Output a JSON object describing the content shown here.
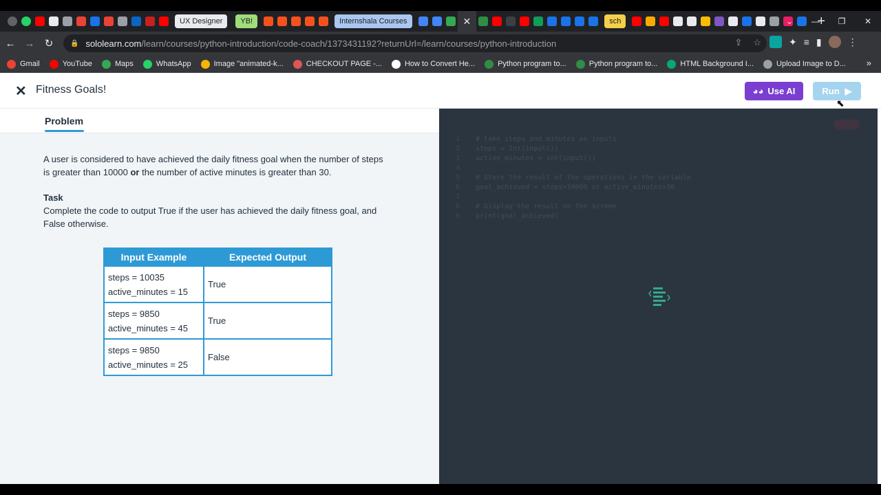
{
  "browser": {
    "tabs": [
      {
        "label": "UX Designer",
        "color": "#e8eaed"
      },
      {
        "label": "YB!",
        "color": "#9fdc7a"
      },
      {
        "label": "Internshala Courses",
        "color": "#a9c7f0"
      },
      {
        "label": "sch",
        "color": "#f5d04a"
      }
    ],
    "active_tab_close": "✕",
    "new_tab": "+",
    "url_domain": "sololearn.com",
    "url_path": "/learn/courses/python-introduction/code-coach/1373431192?returnUrl=/learn/courses/python-introduction"
  },
  "bookmarks": [
    {
      "label": "Gmail",
      "color": "#ea4335"
    },
    {
      "label": "YouTube",
      "color": "#ff0000"
    },
    {
      "label": "Maps",
      "color": "#34a853"
    },
    {
      "label": "WhatsApp",
      "color": "#25d366"
    },
    {
      "label": "Image \"animated-k...",
      "color": "#f7b500"
    },
    {
      "label": "CHECKOUT PAGE -...",
      "color": "#e05555"
    },
    {
      "label": "How to Convert He...",
      "color": "#ffffff"
    },
    {
      "label": "Python program to...",
      "color": "#2f8d46"
    },
    {
      "label": "Python program to...",
      "color": "#2f8d46"
    },
    {
      "label": "HTML Background I...",
      "color": "#04aa6d"
    },
    {
      "label": "Upload Image to D...",
      "color": "#9aa0a6"
    }
  ],
  "bookmarks_more": "»",
  "header": {
    "title": "Fitness Goals!",
    "use_ai_label": "Use AI",
    "run_label": "Run",
    "accent": "#7a3fd0",
    "run_color": "#a5d4ef"
  },
  "problem": {
    "tab_label": "Problem",
    "description_part1": "A user is considered to have achieved the daily fitness goal when the number of steps is greater than 10000 ",
    "description_bold": "or",
    "description_part2": " the number of active minutes is greater than 30.",
    "task_heading": "Task",
    "task_text": "Complete the code to output True if the user has achieved the daily fitness goal, and False otherwise."
  },
  "examples": {
    "headers": [
      "Input Example",
      "Expected Output"
    ],
    "rows": [
      {
        "input_line1": "steps = 10035",
        "input_line2": "active_minutes = 15",
        "output": "True"
      },
      {
        "input_line1": "steps = 9850",
        "input_line2": "active_minutes = 45",
        "output": "True"
      },
      {
        "input_line1": "steps = 9850",
        "input_line2": "active_minutes = 25",
        "output": "False"
      }
    ]
  },
  "code": {
    "lines": [
      {
        "num": "1",
        "text": "# take steps and minutes as inputs"
      },
      {
        "num": "2",
        "text": "steps = int(input())"
      },
      {
        "num": "3",
        "text": "active_minutes = int(input())"
      },
      {
        "num": "4",
        "text": ""
      },
      {
        "num": "5",
        "text": "# Store the result of the operations in the variable"
      },
      {
        "num": "6",
        "text": "goal_achieved = steps>10000 or active_minutes>30"
      },
      {
        "num": "7",
        "text": ""
      },
      {
        "num": "8",
        "text": "# Display the result on the screen"
      },
      {
        "num": "9",
        "text": "print(goal_achieved)"
      }
    ]
  }
}
